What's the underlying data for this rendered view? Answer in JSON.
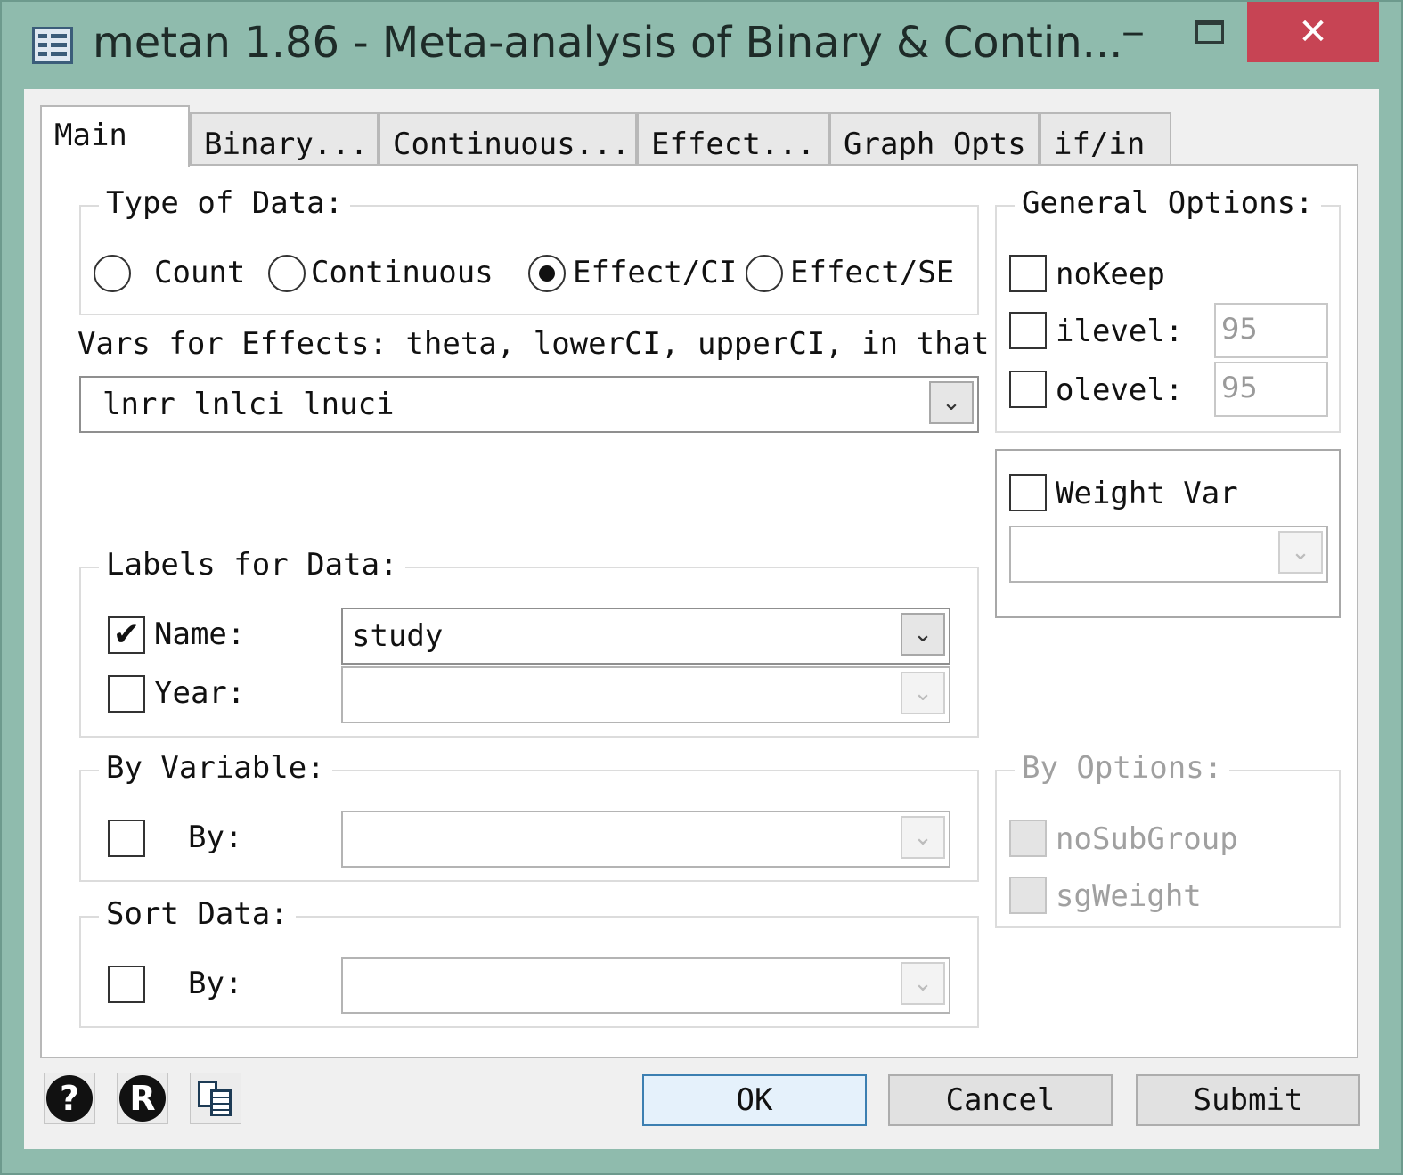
{
  "window": {
    "title": "metan 1.86 - Meta-analysis of Binary & Contin...",
    "minimize_glyph": "‒",
    "close_glyph": "✕"
  },
  "tabs": [
    {
      "label": "Main",
      "active": true
    },
    {
      "label": "Binary..."
    },
    {
      "label": "Continuous..."
    },
    {
      "label": "Effect..."
    },
    {
      "label": "Graph Opts"
    },
    {
      "label": "if/in"
    }
  ],
  "type_of_data": {
    "label": "Type of Data:",
    "options": [
      {
        "label": "Count",
        "checked": false
      },
      {
        "label": "Continuous",
        "checked": false
      },
      {
        "label": "Effect/CI",
        "checked": true
      },
      {
        "label": "Effect/SE",
        "checked": false
      }
    ]
  },
  "vars_for_effects": {
    "description": "Vars for Effects: theta, lowerCI, upperCI, in that",
    "value": "lnrr lnlci lnuci"
  },
  "labels_for_data": {
    "label": "Labels for Data:",
    "name": {
      "label": "Name:",
      "checked": true,
      "check_glyph": "✔",
      "value": "study"
    },
    "year": {
      "label": "Year:",
      "checked": false,
      "value": ""
    }
  },
  "by_variable": {
    "label": "By Variable:",
    "by": {
      "label": "By:",
      "checked": false,
      "value": ""
    }
  },
  "sort_data": {
    "label": "Sort Data:",
    "by": {
      "label": "By:",
      "checked": false,
      "value": ""
    }
  },
  "general_options": {
    "label": "General Options:",
    "nokeep": {
      "label": "noKeep",
      "checked": false
    },
    "ilevel": {
      "label": "ilevel:",
      "checked": false,
      "value": "95"
    },
    "olevel": {
      "label": "olevel:",
      "checked": false,
      "value": "95"
    }
  },
  "weight_var": {
    "label": "Weight Var",
    "checked": false,
    "value": ""
  },
  "by_options": {
    "label": "By Options:",
    "nosubgroup": {
      "label": "noSubGroup",
      "checked": false
    },
    "sgweight": {
      "label": "sgWeight",
      "checked": false
    }
  },
  "footer": {
    "help_glyph": "?",
    "reset_glyph": "R",
    "ok_label": "OK",
    "cancel_label": "Cancel",
    "submit_label": "Submit"
  },
  "icons": {
    "dropdown_arrow": "⌄",
    "help": "help-icon",
    "reset": "reset-icon",
    "copy": "copy-command-icon",
    "app": "dialog-app-icon"
  },
  "colors": {
    "frame": "#8fbbad",
    "close_button": "#c74454",
    "default_button_border": "#3c7fb1",
    "disabled_text": "#a0a0a0"
  }
}
